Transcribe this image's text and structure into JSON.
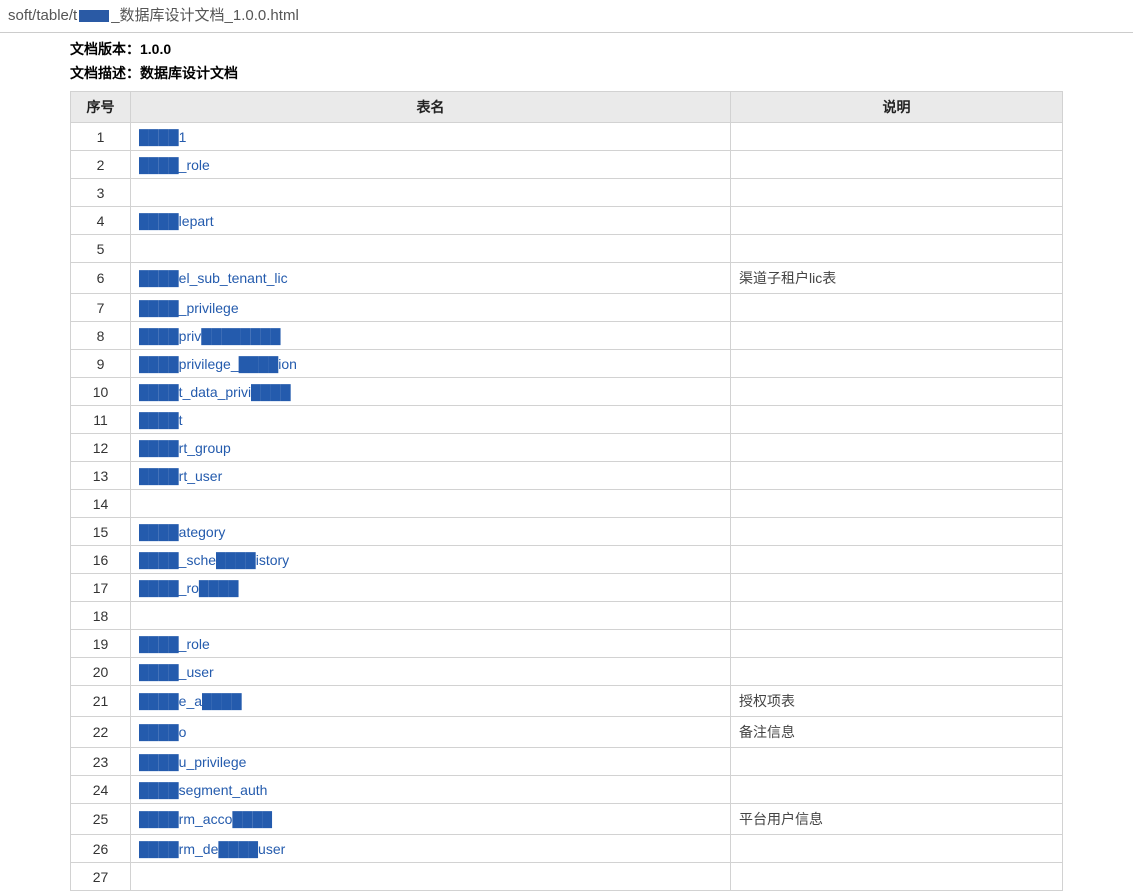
{
  "address": {
    "prefix": "soft/table/t",
    "suffix": "_数据库设计文档_1.0.0.html"
  },
  "meta": {
    "version_label": "文档版本：",
    "version_value": "1.0.0",
    "desc_label": "文档描述：",
    "desc_value": "数据库设计文档"
  },
  "columns": {
    "num": "序号",
    "name": "表名",
    "desc": "说明"
  },
  "rows": [
    {
      "num": "1",
      "name": "████1",
      "desc": ""
    },
    {
      "num": "2",
      "name": "████_role",
      "desc": ""
    },
    {
      "num": "3",
      "name": "",
      "desc": ""
    },
    {
      "num": "4",
      "name": "████lepart",
      "desc": ""
    },
    {
      "num": "5",
      "name": "",
      "desc": ""
    },
    {
      "num": "6",
      "name": "████el_sub_tenant_lic",
      "desc": "渠道子租户lic表"
    },
    {
      "num": "7",
      "name": "████_privilege",
      "desc": ""
    },
    {
      "num": "8",
      "name": "████priv████████",
      "desc": ""
    },
    {
      "num": "9",
      "name": "████privilege_████ion",
      "desc": ""
    },
    {
      "num": "10",
      "name": "████t_data_privi████",
      "desc": ""
    },
    {
      "num": "11",
      "name": "████t",
      "desc": ""
    },
    {
      "num": "12",
      "name": "████rt_group",
      "desc": ""
    },
    {
      "num": "13",
      "name": "████rt_user",
      "desc": ""
    },
    {
      "num": "14",
      "name": "",
      "desc": ""
    },
    {
      "num": "15",
      "name": "████ategory",
      "desc": ""
    },
    {
      "num": "16",
      "name": "████_sche████istory",
      "desc": ""
    },
    {
      "num": "17",
      "name": "████_ro████",
      "desc": ""
    },
    {
      "num": "18",
      "name": "",
      "desc": ""
    },
    {
      "num": "19",
      "name": "████_role",
      "desc": ""
    },
    {
      "num": "20",
      "name": "████_user",
      "desc": ""
    },
    {
      "num": "21",
      "name": "████e_a████",
      "desc": "授权项表"
    },
    {
      "num": "22",
      "name": "████o",
      "desc": "备注信息"
    },
    {
      "num": "23",
      "name": "████u_privilege",
      "desc": ""
    },
    {
      "num": "24",
      "name": "████segment_auth",
      "desc": ""
    },
    {
      "num": "25",
      "name": "████rm_acco████",
      "desc": "平台用户信息"
    },
    {
      "num": "26",
      "name": "████rm_de████user",
      "desc": ""
    },
    {
      "num": "27",
      "name": "",
      "desc": ""
    }
  ]
}
